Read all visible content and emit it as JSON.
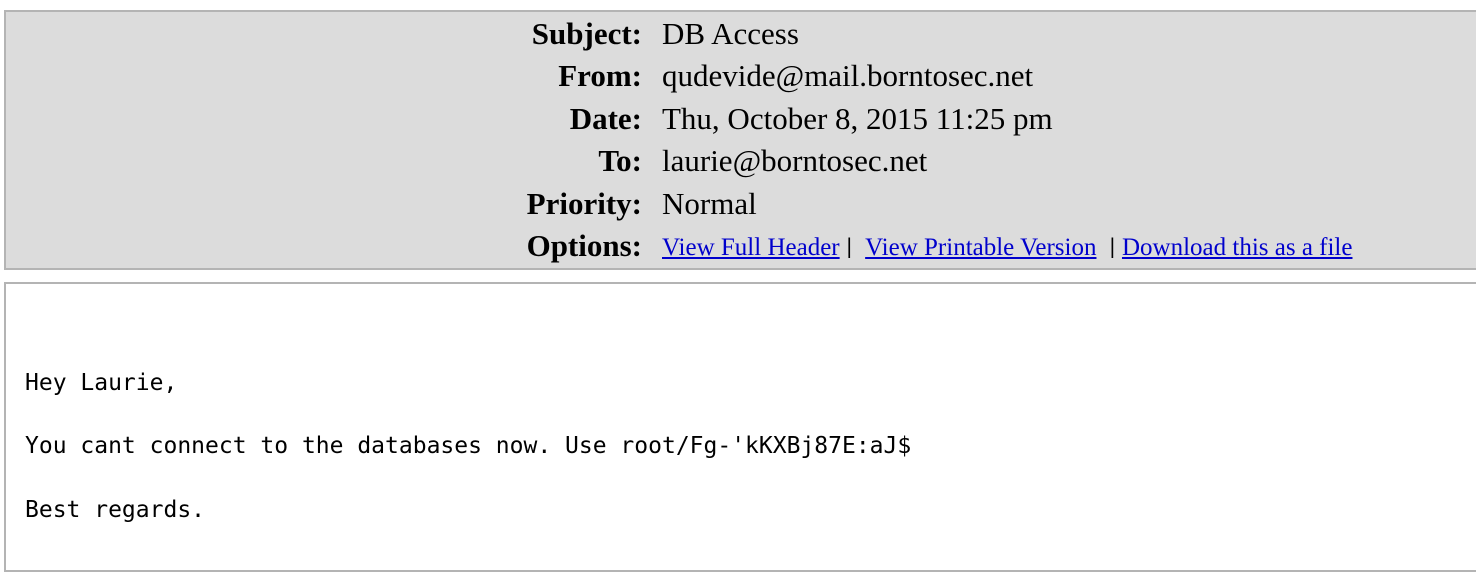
{
  "header": {
    "subject": {
      "label": "Subject:",
      "value": "DB Access"
    },
    "from": {
      "label": "From:",
      "value": "qudevide@mail.borntosec.net"
    },
    "date": {
      "label": "Date:",
      "value": "Thu, October 8, 2015 11:25 pm"
    },
    "to": {
      "label": "To:",
      "value": "laurie@borntosec.net"
    },
    "priority": {
      "label": "Priority:",
      "value": "Normal"
    },
    "options": {
      "label": "Options:",
      "links": [
        {
          "label": "View Full Header"
        },
        {
          "label": "View Printable Version"
        },
        {
          "label": "Download this as a file"
        }
      ],
      "separator": "|"
    }
  },
  "message": {
    "lines": [
      "Hey Laurie,",
      "You cant connect to the databases now. Use root/Fg-'kKXBj87E:aJ$",
      "Best regards."
    ]
  }
}
